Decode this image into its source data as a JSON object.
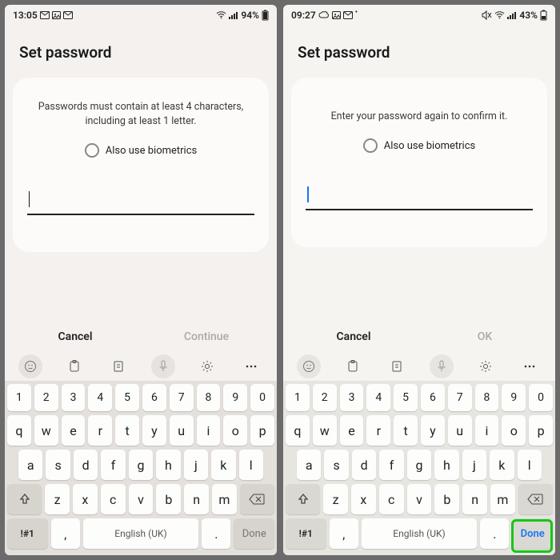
{
  "left": {
    "status": {
      "time": "13:05",
      "battery": "94%"
    },
    "title": "Set password",
    "instruction": "Passwords must contain at least 4 characters, including at least 1 letter.",
    "biometrics_label": "Also use biometrics",
    "cancel": "Cancel",
    "primary": "Continue",
    "space_label": "English (UK)",
    "sym_label": "!#1",
    "done_label": "Done"
  },
  "right": {
    "status": {
      "time": "09:27",
      "battery": "43%"
    },
    "title": "Set password",
    "instruction": "Enter your password again to confirm it.",
    "biometrics_label": "Also use biometrics",
    "cancel": "Cancel",
    "primary": "OK",
    "space_label": "English (UK)",
    "sym_label": "!#1",
    "done_label": "Done"
  },
  "keys": {
    "numbers": [
      "1",
      "2",
      "3",
      "4",
      "5",
      "6",
      "7",
      "8",
      "9",
      "0"
    ],
    "row1": [
      "q",
      "w",
      "e",
      "r",
      "t",
      "y",
      "u",
      "i",
      "o",
      "p"
    ],
    "row2": [
      "a",
      "s",
      "d",
      "f",
      "g",
      "h",
      "j",
      "k",
      "l"
    ],
    "row3": [
      "z",
      "x",
      "c",
      "v",
      "b",
      "n",
      "m"
    ],
    "comma": ",",
    "dot": "."
  }
}
